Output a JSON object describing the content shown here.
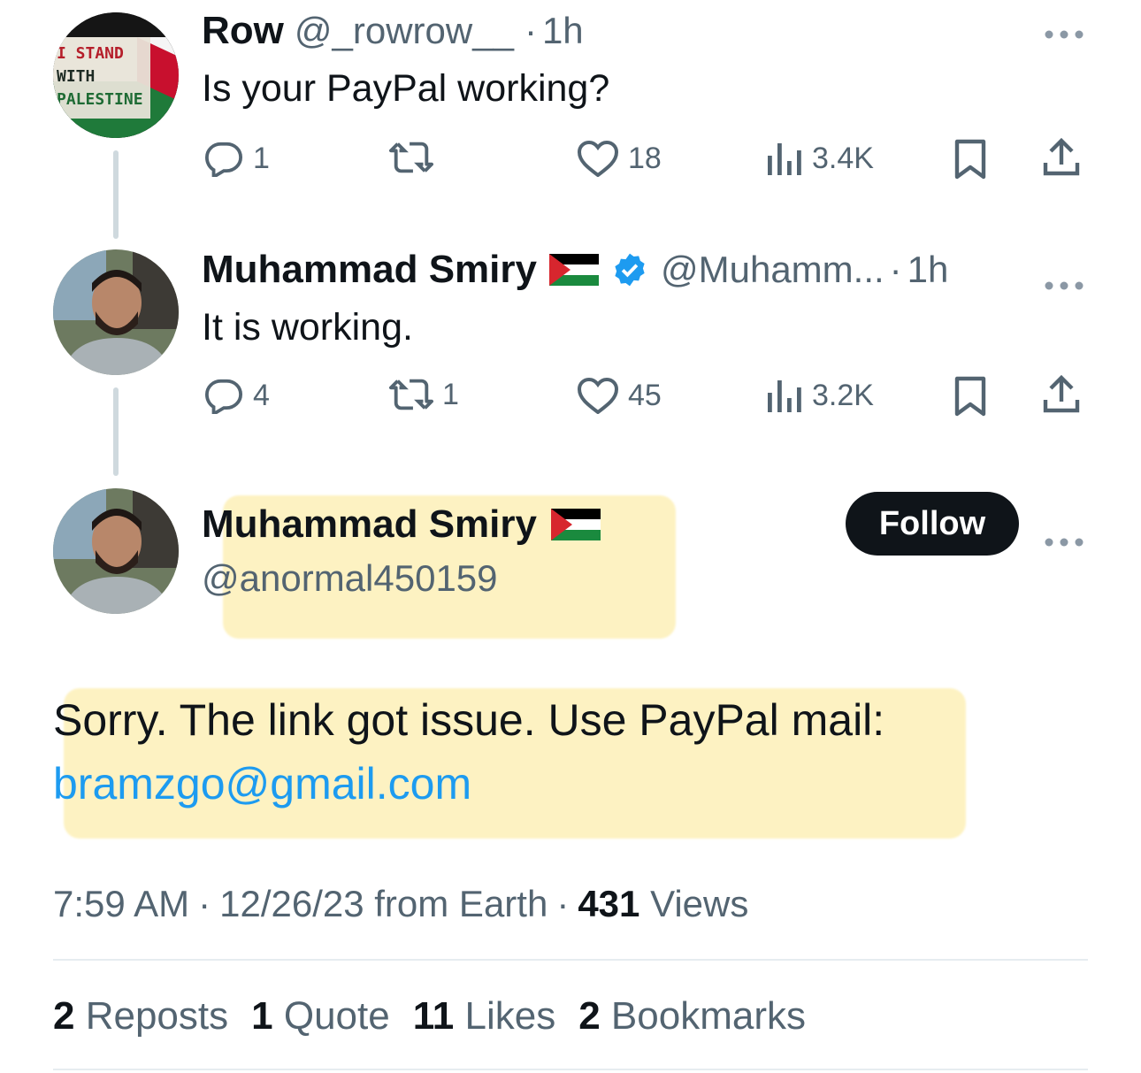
{
  "tweet1": {
    "avatar_text": [
      "I STAND",
      "WITH",
      "PALESTINE"
    ],
    "name": "Row",
    "handle": "@_rowrow__",
    "sep": "·",
    "time": "1h",
    "text": "Is your PayPal working?",
    "replies": "1",
    "reposts": "",
    "likes": "18",
    "views": "3.4K"
  },
  "tweet2": {
    "name": "Muhammad Smiry",
    "handle": "@Muhamm...",
    "sep": "·",
    "time": "1h",
    "text": "It is working.",
    "replies": "4",
    "reposts": "1",
    "likes": "45",
    "views": "3.2K"
  },
  "main": {
    "name": "Muhammad Smiry",
    "handle": "@anormal450159",
    "follow_label": "Follow",
    "text": "Sorry. The link got issue. Use PayPal mail:",
    "email": "bramzgo@gmail.com",
    "time": "7:59 AM",
    "date": "12/26/23 from Earth",
    "sep": "·",
    "views_count": "431",
    "views_label": "Views",
    "stats": {
      "reposts_count": "2",
      "reposts_label": "Reposts",
      "quotes_count": "1",
      "quotes_label": "Quote",
      "likes_count": "11",
      "likes_label": "Likes",
      "bookmarks_count": "2",
      "bookmarks_label": "Bookmarks"
    }
  },
  "colors": {
    "text": "#0f1419",
    "muted": "#536471",
    "link": "#1d9bf0",
    "verified": "#1d9bf0",
    "highlight": "#fdf0b8"
  },
  "icons": [
    "more-icon",
    "reply-icon",
    "repost-icon",
    "like-icon",
    "views-icon",
    "bookmark-icon",
    "share-icon",
    "verified-badge-icon",
    "palestine-flag-icon"
  ]
}
